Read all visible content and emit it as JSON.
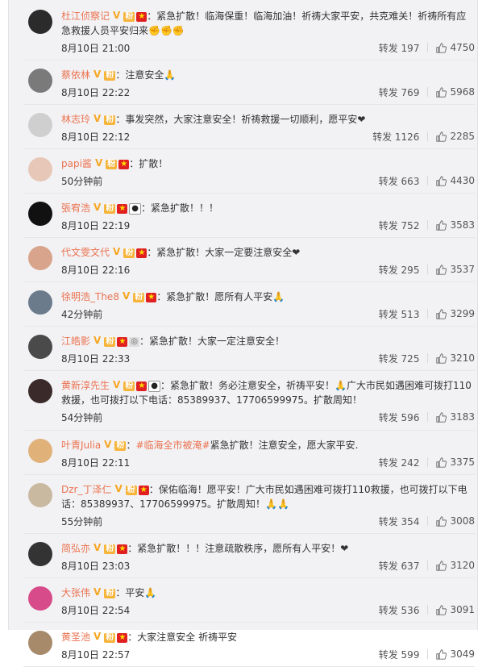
{
  "labels": {
    "repost": "转发"
  },
  "comments": [
    {
      "user": "杜江侦察记",
      "badges": [
        "v",
        "fan",
        "flag"
      ],
      "text": "：紧急扩散！临海保重！临海加油！祈祷大家平安，共克难关！祈祷所有应急救援人员平安归来✊✊✊",
      "time": "8月10日 21:00",
      "reposts": "197",
      "likes": "4750"
    },
    {
      "user": "蔡依林",
      "badges": [
        "v",
        "fan"
      ],
      "text": "：注意安全🙏",
      "time": "8月10日 22:22",
      "reposts": "769",
      "likes": "5968"
    },
    {
      "user": "林志玲",
      "badges": [
        "v",
        "fan"
      ],
      "text": "：事发突然，大家注意安全！祈祷救援一切顺利，愿平安❤",
      "time": "8月10日 22:12",
      "reposts": "1126",
      "likes": "2285"
    },
    {
      "user": "papi酱",
      "badges": [
        "v",
        "fan",
        "flag"
      ],
      "text": "：扩散！",
      "time": "50分钟前",
      "reposts": "663",
      "likes": "4430"
    },
    {
      "user": "張宥浩",
      "badges": [
        "v",
        "fan",
        "flag",
        "panda"
      ],
      "text": "：紧急扩散！！！",
      "time": "8月10日 22:19",
      "reposts": "752",
      "likes": "3583"
    },
    {
      "user": "代文雯文代",
      "badges": [
        "v",
        "fan",
        "flag"
      ],
      "text": "：紧急扩散！大家一定要注意安全❤",
      "time": "8月10日 22:16",
      "reposts": "295",
      "likes": "3537"
    },
    {
      "user": "徐明浩_The8",
      "badges": [
        "v",
        "fan",
        "flag"
      ],
      "text": "：紧急扩散！愿所有人平安🙏",
      "time": "42分钟前",
      "reposts": "513",
      "likes": "3299"
    },
    {
      "user": "江皓影",
      "badges": [
        "v",
        "fan",
        "flag",
        "medal"
      ],
      "text": "：紧急扩散！大家一定注意安全！",
      "time": "8月10日 22:33",
      "reposts": "725",
      "likes": "3210"
    },
    {
      "user": "黄新淳先生",
      "badges": [
        "v",
        "fan",
        "flag",
        "panda"
      ],
      "text": "：紧急扩散！务必注意安全，祈祷平安！🙏广大市民如遇困难可拨打110救援，也可拨打以下电话：85389937、17706599975。扩散周知！",
      "time": "54分钟前",
      "reposts": "596",
      "likes": "3183"
    },
    {
      "user": "叶青Julia",
      "badges": [
        "v",
        "fan"
      ],
      "topic": "#临海全市被淹#",
      "text": "紧急扩散！注意安全，愿大家平安.",
      "time": "8月10日 22:11",
      "reposts": "242",
      "likes": "3375"
    },
    {
      "user": "Dzr_丁泽仁",
      "badges": [
        "v",
        "fan",
        "flag"
      ],
      "text": "：保佑临海！愿平安！广大市民如遇困难可拨打110救援，也可拨打以下电话：85389937、17706599975。扩散周知！🙏🙏",
      "time": "55分钟前",
      "reposts": "354",
      "likes": "3008"
    },
    {
      "user": "简弘亦",
      "badges": [
        "v",
        "fan",
        "flag"
      ],
      "text": "：紧急扩散！！！注意疏散秩序，愿所有人平安！❤",
      "time": "8月10日 23:03",
      "reposts": "637",
      "likes": "3120"
    },
    {
      "user": "大张伟",
      "badges": [
        "v",
        "fan"
      ],
      "text": "：平安🙏",
      "time": "8月10日 22:54",
      "reposts": "536",
      "likes": "3091"
    },
    {
      "user": "黄圣池",
      "badges": [
        "v",
        "fan",
        "flag"
      ],
      "text": "：大家注意安全 祈祷平安",
      "time": "8月10日 22:57",
      "reposts": "599",
      "likes": "3049"
    }
  ],
  "colors": {
    "username": "#eb7350",
    "background": "#f2f2f5",
    "divider": "#e6e6e6"
  }
}
